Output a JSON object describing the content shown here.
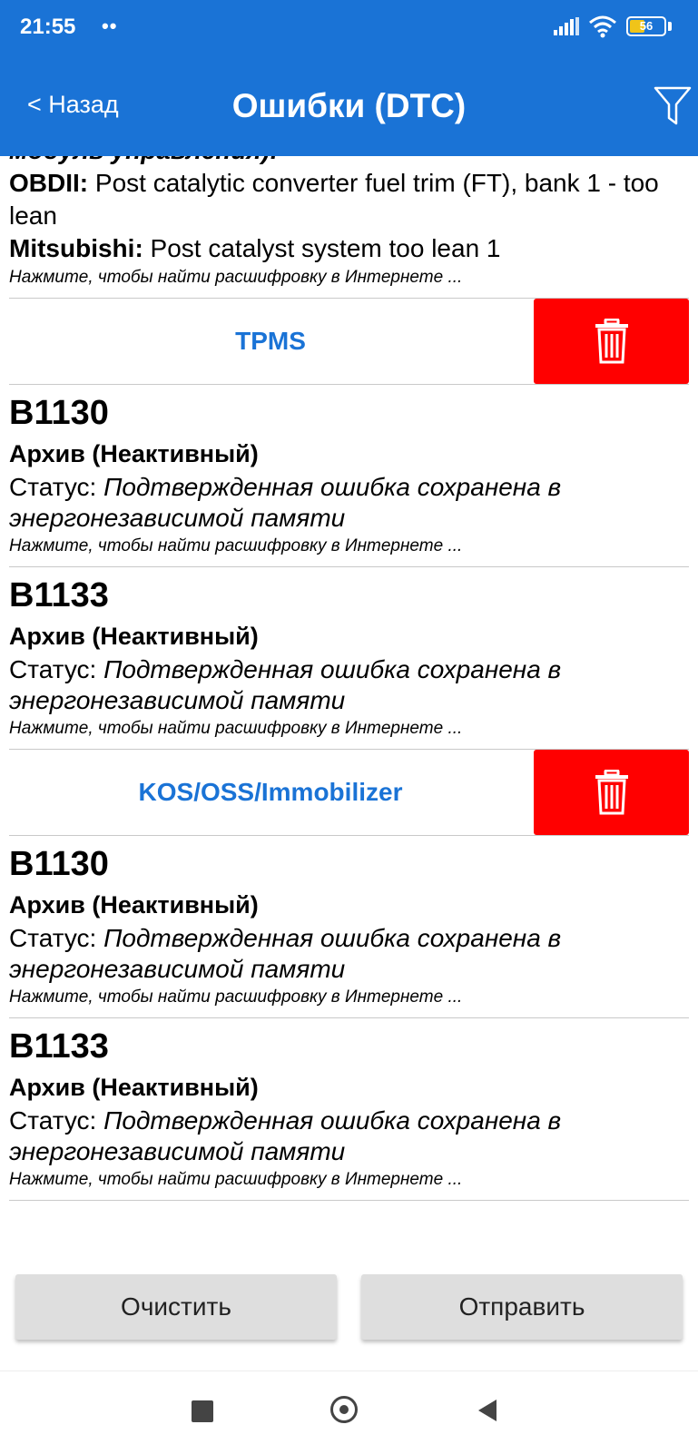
{
  "status_bar": {
    "time": "21:55",
    "dots": "••",
    "battery": "56"
  },
  "header": {
    "back": "< Назад",
    "title": "Ошибки (DTC)",
    "filter_icon": "filter-icon"
  },
  "top_entry": {
    "cut_text": "модуль управления):",
    "obd_label": "OBDII:",
    "obd_text": " Post catalytic converter fuel trim (FT), bank 1 - too lean",
    "mfr_label": "Mitsubishi:",
    "mfr_text": " Post catalyst system too lean 1",
    "hint": "Нажмите, чтобы найти расшифровку в Интернете ..."
  },
  "groups": [
    {
      "name": "TPMS",
      "codes": [
        {
          "code": "B1130",
          "state": "Архив (Неактивный)",
          "status_label": "Статус: ",
          "status_value": "Подтвержденная ошибка сохранена в энергонезависимой памяти",
          "hint": "Нажмите, чтобы найти расшифровку в Интернете ..."
        },
        {
          "code": "B1133",
          "state": "Архив (Неактивный)",
          "status_label": "Статус: ",
          "status_value": "Подтвержденная ошибка сохранена в энергонезависимой памяти",
          "hint": "Нажмите, чтобы найти расшифровку в Интернете ..."
        }
      ]
    },
    {
      "name": "KOS/OSS/Immobilizer",
      "codes": [
        {
          "code": "B1130",
          "state": "Архив (Неактивный)",
          "status_label": "Статус: ",
          "status_value": "Подтвержденная ошибка сохранена в энергонезависимой памяти",
          "hint": "Нажмите, чтобы найти расшифровку в Интернете ..."
        },
        {
          "code": "B1133",
          "state": "Архив (Неактивный)",
          "status_label": "Статус: ",
          "status_value": "Подтвержденная ошибка сохранена в энергонезависимой памяти",
          "hint": "Нажмите, чтобы найти расшифровку в Интернете ..."
        }
      ]
    }
  ],
  "buttons": {
    "clear": "Очистить",
    "send": "Отправить"
  },
  "colors": {
    "primary": "#1a73d6",
    "delete": "#ff0000",
    "button_bg": "#dedede"
  }
}
